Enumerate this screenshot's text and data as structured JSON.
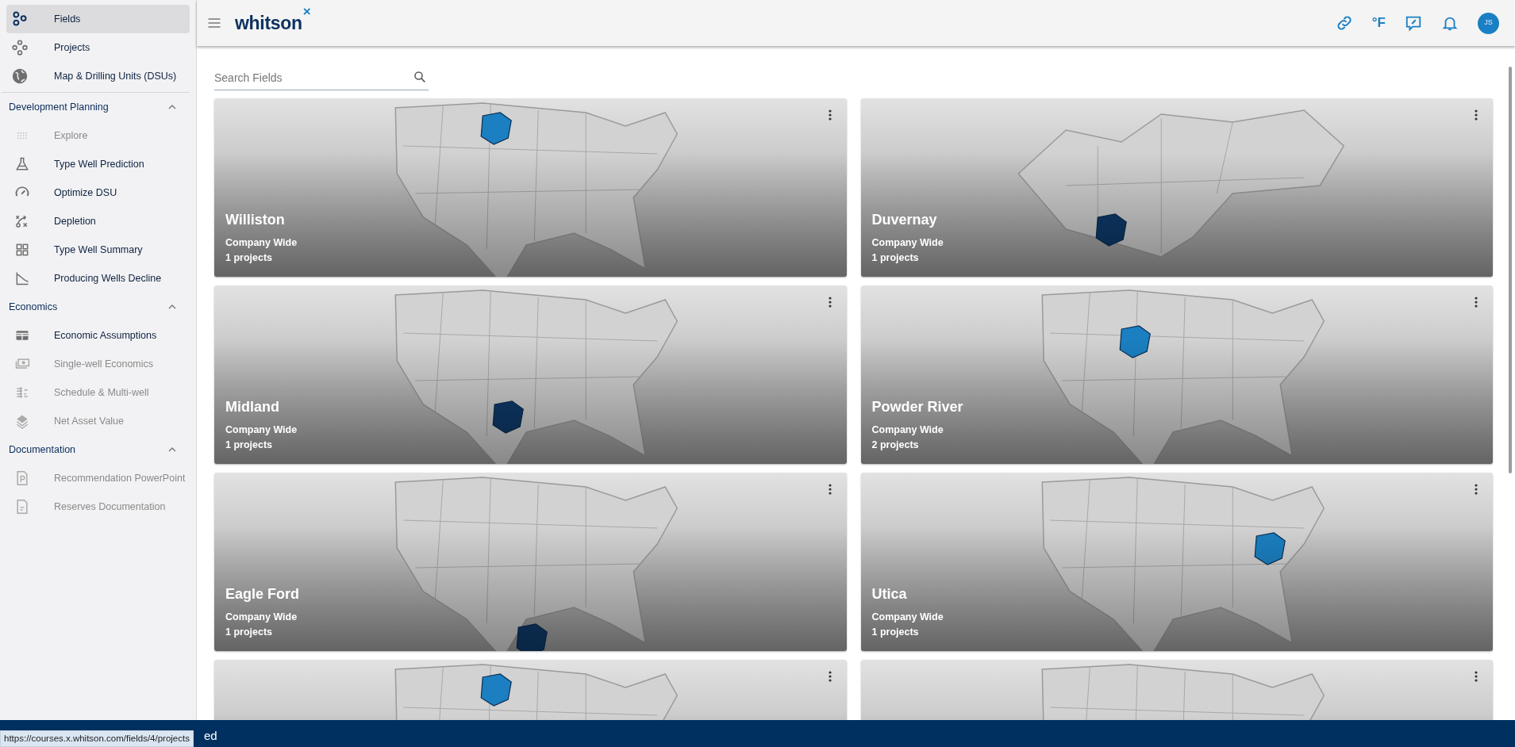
{
  "header": {
    "logo": {
      "name": "whitson",
      "mark": "×"
    },
    "unit": "°F",
    "avatar": "JS"
  },
  "sidebar": {
    "items": [
      {
        "label": "Fields",
        "selected": true
      },
      {
        "label": "Projects",
        "selected": false
      },
      {
        "label": "Map & Drilling Units (DSUs)",
        "selected": false
      }
    ],
    "sections": [
      {
        "title": "Development Planning",
        "expanded": true,
        "items": [
          {
            "label": "Explore",
            "disabled": true,
            "selected": false
          },
          {
            "label": "Type Well Prediction",
            "disabled": false,
            "selected": false
          },
          {
            "label": "Optimize DSU",
            "disabled": false,
            "selected": false
          },
          {
            "label": "Depletion",
            "disabled": false,
            "selected": false
          },
          {
            "label": "Type Well Summary",
            "disabled": false,
            "selected": false
          },
          {
            "label": "Producing Wells Decline",
            "disabled": false,
            "selected": false
          }
        ]
      },
      {
        "title": "Economics",
        "expanded": true,
        "items": [
          {
            "label": "Economic Assumptions",
            "disabled": false,
            "selected": false
          },
          {
            "label": "Single-well Economics",
            "disabled": true,
            "selected": false
          },
          {
            "label": "Schedule & Multi-well",
            "disabled": true,
            "selected": false
          },
          {
            "label": "Net Asset Value",
            "disabled": true,
            "selected": false
          }
        ]
      },
      {
        "title": "Documentation",
        "expanded": true,
        "items": [
          {
            "label": "Recommendation PowerPoint",
            "disabled": true,
            "selected": false
          },
          {
            "label": "Reserves Documentation",
            "disabled": true,
            "selected": false
          }
        ]
      }
    ]
  },
  "search": {
    "placeholder": "Search Fields"
  },
  "cards": [
    {
      "kind": "full",
      "title": "Williston",
      "scope": "Company Wide",
      "projects": "1 projects"
    },
    {
      "kind": "full",
      "title": "Duvernay",
      "scope": "Company Wide",
      "projects": "1 projects"
    },
    {
      "kind": "full",
      "title": "Midland",
      "scope": "Company Wide",
      "projects": "1 projects"
    },
    {
      "kind": "full",
      "title": "Powder River",
      "scope": "Company Wide",
      "projects": "2 projects"
    },
    {
      "kind": "full",
      "title": "Eagle Ford",
      "scope": "Company Wide",
      "projects": "1 projects"
    },
    {
      "kind": "full",
      "title": "Utica",
      "scope": "Company Wide",
      "projects": "1 projects"
    },
    {
      "kind": "cut"
    },
    {
      "kind": "cut"
    }
  ],
  "footer": {
    "text": "ed"
  },
  "status_url": "https://courses.x.whitson.com/fields/4/projects"
}
